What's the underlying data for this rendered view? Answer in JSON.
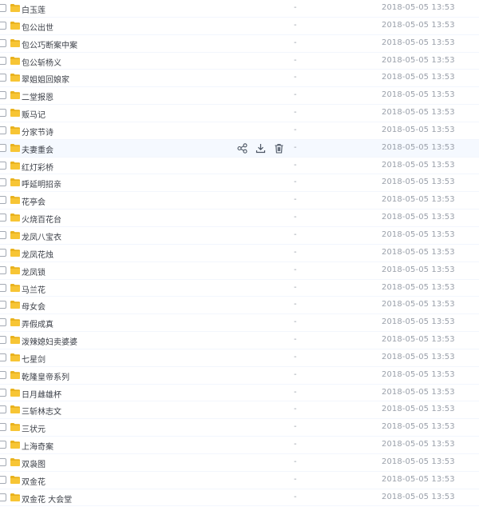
{
  "file_list": {
    "rows": [
      {
        "name": "白玉莲",
        "size": "-",
        "date": "2018-05-05 13:53"
      },
      {
        "name": "包公出世",
        "size": "-",
        "date": "2018-05-05 13:53"
      },
      {
        "name": "包公巧断案中案",
        "size": "-",
        "date": "2018-05-05 13:53"
      },
      {
        "name": "包公斩杨义",
        "size": "-",
        "date": "2018-05-05 13:53"
      },
      {
        "name": "翠姐姐回娘家",
        "size": "-",
        "date": "2018-05-05 13:53"
      },
      {
        "name": "二堂报恩",
        "size": "-",
        "date": "2018-05-05 13:53"
      },
      {
        "name": "贩马记",
        "size": "-",
        "date": "2018-05-05 13:53"
      },
      {
        "name": "分家节诗",
        "size": "-",
        "date": "2018-05-05 13:53"
      },
      {
        "name": "夫妻重会",
        "size": "-",
        "date": "2018-05-05 13:53"
      },
      {
        "name": "红灯彩桥",
        "size": "-",
        "date": "2018-05-05 13:53"
      },
      {
        "name": "呼延明招亲",
        "size": "-",
        "date": "2018-05-05 13:53"
      },
      {
        "name": "花亭会",
        "size": "-",
        "date": "2018-05-05 13:53"
      },
      {
        "name": "火烧百花台",
        "size": "-",
        "date": "2018-05-05 13:53"
      },
      {
        "name": "龙凤八宝衣",
        "size": "-",
        "date": "2018-05-05 13:53"
      },
      {
        "name": "龙凤花烛",
        "size": "-",
        "date": "2018-05-05 13:53"
      },
      {
        "name": "龙凤锁",
        "size": "-",
        "date": "2018-05-05 13:53"
      },
      {
        "name": "马兰花",
        "size": "-",
        "date": "2018-05-05 13:53"
      },
      {
        "name": "母女会",
        "size": "-",
        "date": "2018-05-05 13:53"
      },
      {
        "name": "弄假成真",
        "size": "-",
        "date": "2018-05-05 13:53"
      },
      {
        "name": "泼辣媳妇卖婆婆",
        "size": "-",
        "date": "2018-05-05 13:53"
      },
      {
        "name": "七星剑",
        "size": "-",
        "date": "2018-05-05 13:53"
      },
      {
        "name": "乾隆皇帝系列",
        "size": "-",
        "date": "2018-05-05 13:53"
      },
      {
        "name": "日月雌雄杯",
        "size": "-",
        "date": "2018-05-05 13:53"
      },
      {
        "name": "三斩林志文",
        "size": "-",
        "date": "2018-05-05 13:53"
      },
      {
        "name": "三状元",
        "size": "-",
        "date": "2018-05-05 13:53"
      },
      {
        "name": "上海奇案",
        "size": "-",
        "date": "2018-05-05 13:53"
      },
      {
        "name": "双袅图",
        "size": "-",
        "date": "2018-05-05 13:53"
      },
      {
        "name": "双金花",
        "size": "-",
        "date": "2018-05-05 13:53"
      },
      {
        "name": "双金花 大会堂",
        "size": "-",
        "date": "2018-05-05 13:53"
      }
    ],
    "hover_row_index": 8,
    "hover_actions": [
      "share-icon",
      "download-icon",
      "delete-icon"
    ]
  },
  "colors": {
    "folder": "#f7c535",
    "folder_dark": "#e9b21d",
    "text": "#3b3f47",
    "muted": "#9aa0aa",
    "icon": "#4b5563"
  }
}
